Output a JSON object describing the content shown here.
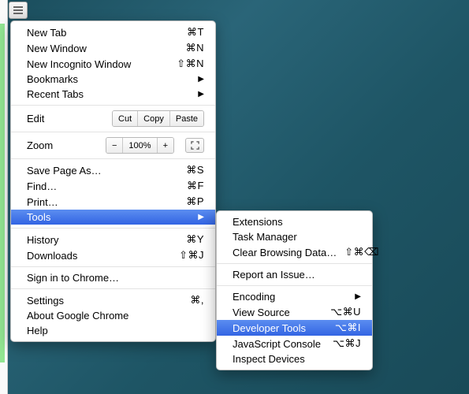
{
  "hamburger": {
    "name": "chrome-menu"
  },
  "mainMenu": {
    "items": [
      {
        "id": "new-tab",
        "label": "New Tab",
        "shortcut": "⌘T"
      },
      {
        "id": "new-window",
        "label": "New Window",
        "shortcut": "⌘N"
      },
      {
        "id": "new-incognito",
        "label": "New Incognito Window",
        "shortcut": "⇧⌘N"
      },
      {
        "id": "bookmarks",
        "label": "Bookmarks",
        "submenu": true
      },
      {
        "id": "recent-tabs",
        "label": "Recent Tabs",
        "submenu": true
      }
    ],
    "edit": {
      "label": "Edit",
      "cut": "Cut",
      "copy": "Copy",
      "paste": "Paste"
    },
    "zoom": {
      "label": "Zoom",
      "minus": "−",
      "value": "100%",
      "plus": "+"
    },
    "items2": [
      {
        "id": "save-page",
        "label": "Save Page As…",
        "shortcut": "⌘S"
      },
      {
        "id": "find",
        "label": "Find…",
        "shortcut": "⌘F"
      },
      {
        "id": "print",
        "label": "Print…",
        "shortcut": "⌘P"
      },
      {
        "id": "tools",
        "label": "Tools",
        "submenu": true,
        "highlighted": true
      }
    ],
    "items3": [
      {
        "id": "history",
        "label": "History",
        "shortcut": "⌘Y"
      },
      {
        "id": "downloads",
        "label": "Downloads",
        "shortcut": "⇧⌘J"
      }
    ],
    "items4": [
      {
        "id": "signin",
        "label": "Sign in to Chrome…"
      }
    ],
    "items5": [
      {
        "id": "settings",
        "label": "Settings",
        "shortcut": "⌘,"
      },
      {
        "id": "about",
        "label": "About Google Chrome"
      },
      {
        "id": "help",
        "label": "Help"
      }
    ]
  },
  "subMenu": {
    "groups": [
      [
        {
          "id": "extensions",
          "label": "Extensions"
        },
        {
          "id": "task-manager",
          "label": "Task Manager"
        },
        {
          "id": "clear-browsing",
          "label": "Clear Browsing Data…",
          "shortcut": "⇧⌘⌫"
        }
      ],
      [
        {
          "id": "report-issue",
          "label": "Report an Issue…"
        }
      ],
      [
        {
          "id": "encoding",
          "label": "Encoding",
          "submenu": true
        },
        {
          "id": "view-source",
          "label": "View Source",
          "shortcut": "⌥⌘U"
        },
        {
          "id": "dev-tools",
          "label": "Developer Tools",
          "shortcut": "⌥⌘I",
          "highlighted": true
        },
        {
          "id": "js-console",
          "label": "JavaScript Console",
          "shortcut": "⌥⌘J"
        },
        {
          "id": "inspect-devices",
          "label": "Inspect Devices"
        }
      ]
    ]
  }
}
